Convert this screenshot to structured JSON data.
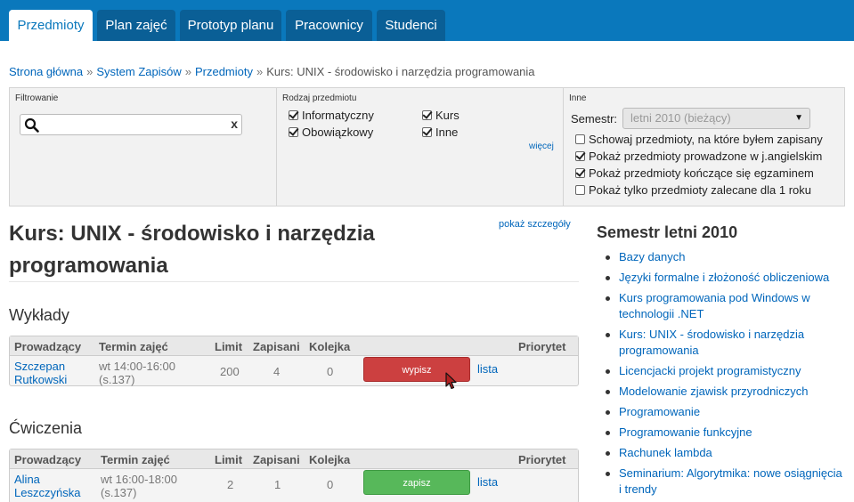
{
  "nav": {
    "tabs": [
      {
        "label": "Przedmioty",
        "active": true
      },
      {
        "label": "Plan zajęć",
        "active": false
      },
      {
        "label": "Prototyp planu",
        "active": false
      },
      {
        "label": "Pracownicy",
        "active": false
      },
      {
        "label": "Studenci",
        "active": false
      }
    ]
  },
  "breadcrumb": {
    "items": [
      "Strona główna",
      "System Zapisów",
      "Przedmioty"
    ],
    "current": "Kurs: UNIX - środowisko i narzędzia programowania",
    "separator": "»"
  },
  "filters": {
    "search": {
      "title": "Filtrowanie",
      "value": "",
      "placeholder": "",
      "clear_label": "x"
    },
    "type": {
      "title": "Rodzaj przedmiotu",
      "options": [
        {
          "label": "Informatyczny",
          "checked": true
        },
        {
          "label": "Kurs",
          "checked": true
        },
        {
          "label": "Obowiązkowy",
          "checked": true
        },
        {
          "label": "Inne",
          "checked": true
        }
      ],
      "more_label": "więcej"
    },
    "other": {
      "title": "Inne",
      "semester_label": "Semestr:",
      "semester_value": "letni 2010 (bieżący)",
      "options": [
        {
          "label": "Schowaj przedmioty, na które byłem zapisany",
          "checked": false
        },
        {
          "label": "Pokaż przedmioty prowadzone w j.angielskim",
          "checked": true
        },
        {
          "label": "Pokaż przedmioty kończące się egzaminem",
          "checked": true
        },
        {
          "label": "Pokaż tylko przedmioty zalecane dla 1 roku",
          "checked": false
        }
      ]
    }
  },
  "course": {
    "title": "Kurs: UNIX - środowisko i narzędzia programowania",
    "details_link": "pokaż szczegóły"
  },
  "lectures": {
    "heading": "Wykłady",
    "headers": {
      "teacher": "Prowadzący",
      "term": "Termin zajęć",
      "limit": "Limit",
      "enrolled": "Zapisani",
      "queue": "Kolejka",
      "priority": "Priorytet"
    },
    "row": {
      "teacher_first": "Szczepan",
      "teacher_last": "Rutkowski",
      "term_time": "wt 14:00-16:00",
      "term_room": "(s.137)",
      "limit": "200",
      "enrolled": "4",
      "queue": "0",
      "action": "wypisz",
      "list": "lista"
    }
  },
  "exercises": {
    "heading": "Ćwiczenia",
    "headers": {
      "teacher": "Prowadzący",
      "term": "Termin zajęć",
      "limit": "Limit",
      "enrolled": "Zapisani",
      "queue": "Kolejka",
      "priority": "Priorytet"
    },
    "row": {
      "teacher_first": "Alina",
      "teacher_last": "Leszczyńska",
      "term_time": "wt 16:00-18:00",
      "term_room": "(s.137)",
      "limit": "2",
      "enrolled": "1",
      "queue": "0",
      "action": "zapisz",
      "list": "lista"
    }
  },
  "sidebar": {
    "title": "Semestr letni 2010",
    "items": [
      "Bazy danych",
      "Języki formalne i złożoność obliczeniowa",
      "Kurs programowania pod Windows w technologii .NET",
      "Kurs: UNIX - środowisko i narzędzia programowania",
      "Licencjacki projekt programistyczny",
      "Modelowanie zjawisk przyrodniczych",
      "Programowanie",
      "Programowanie funkcyjne",
      "Rachunek lambda",
      "Seminarium: Algorytmika: nowe osiągnięcia i trendy"
    ]
  },
  "colors": {
    "nav": "#0a78bc",
    "link": "#0066bb",
    "unsubscribe": "#cc4040",
    "subscribe": "#57b85a"
  }
}
